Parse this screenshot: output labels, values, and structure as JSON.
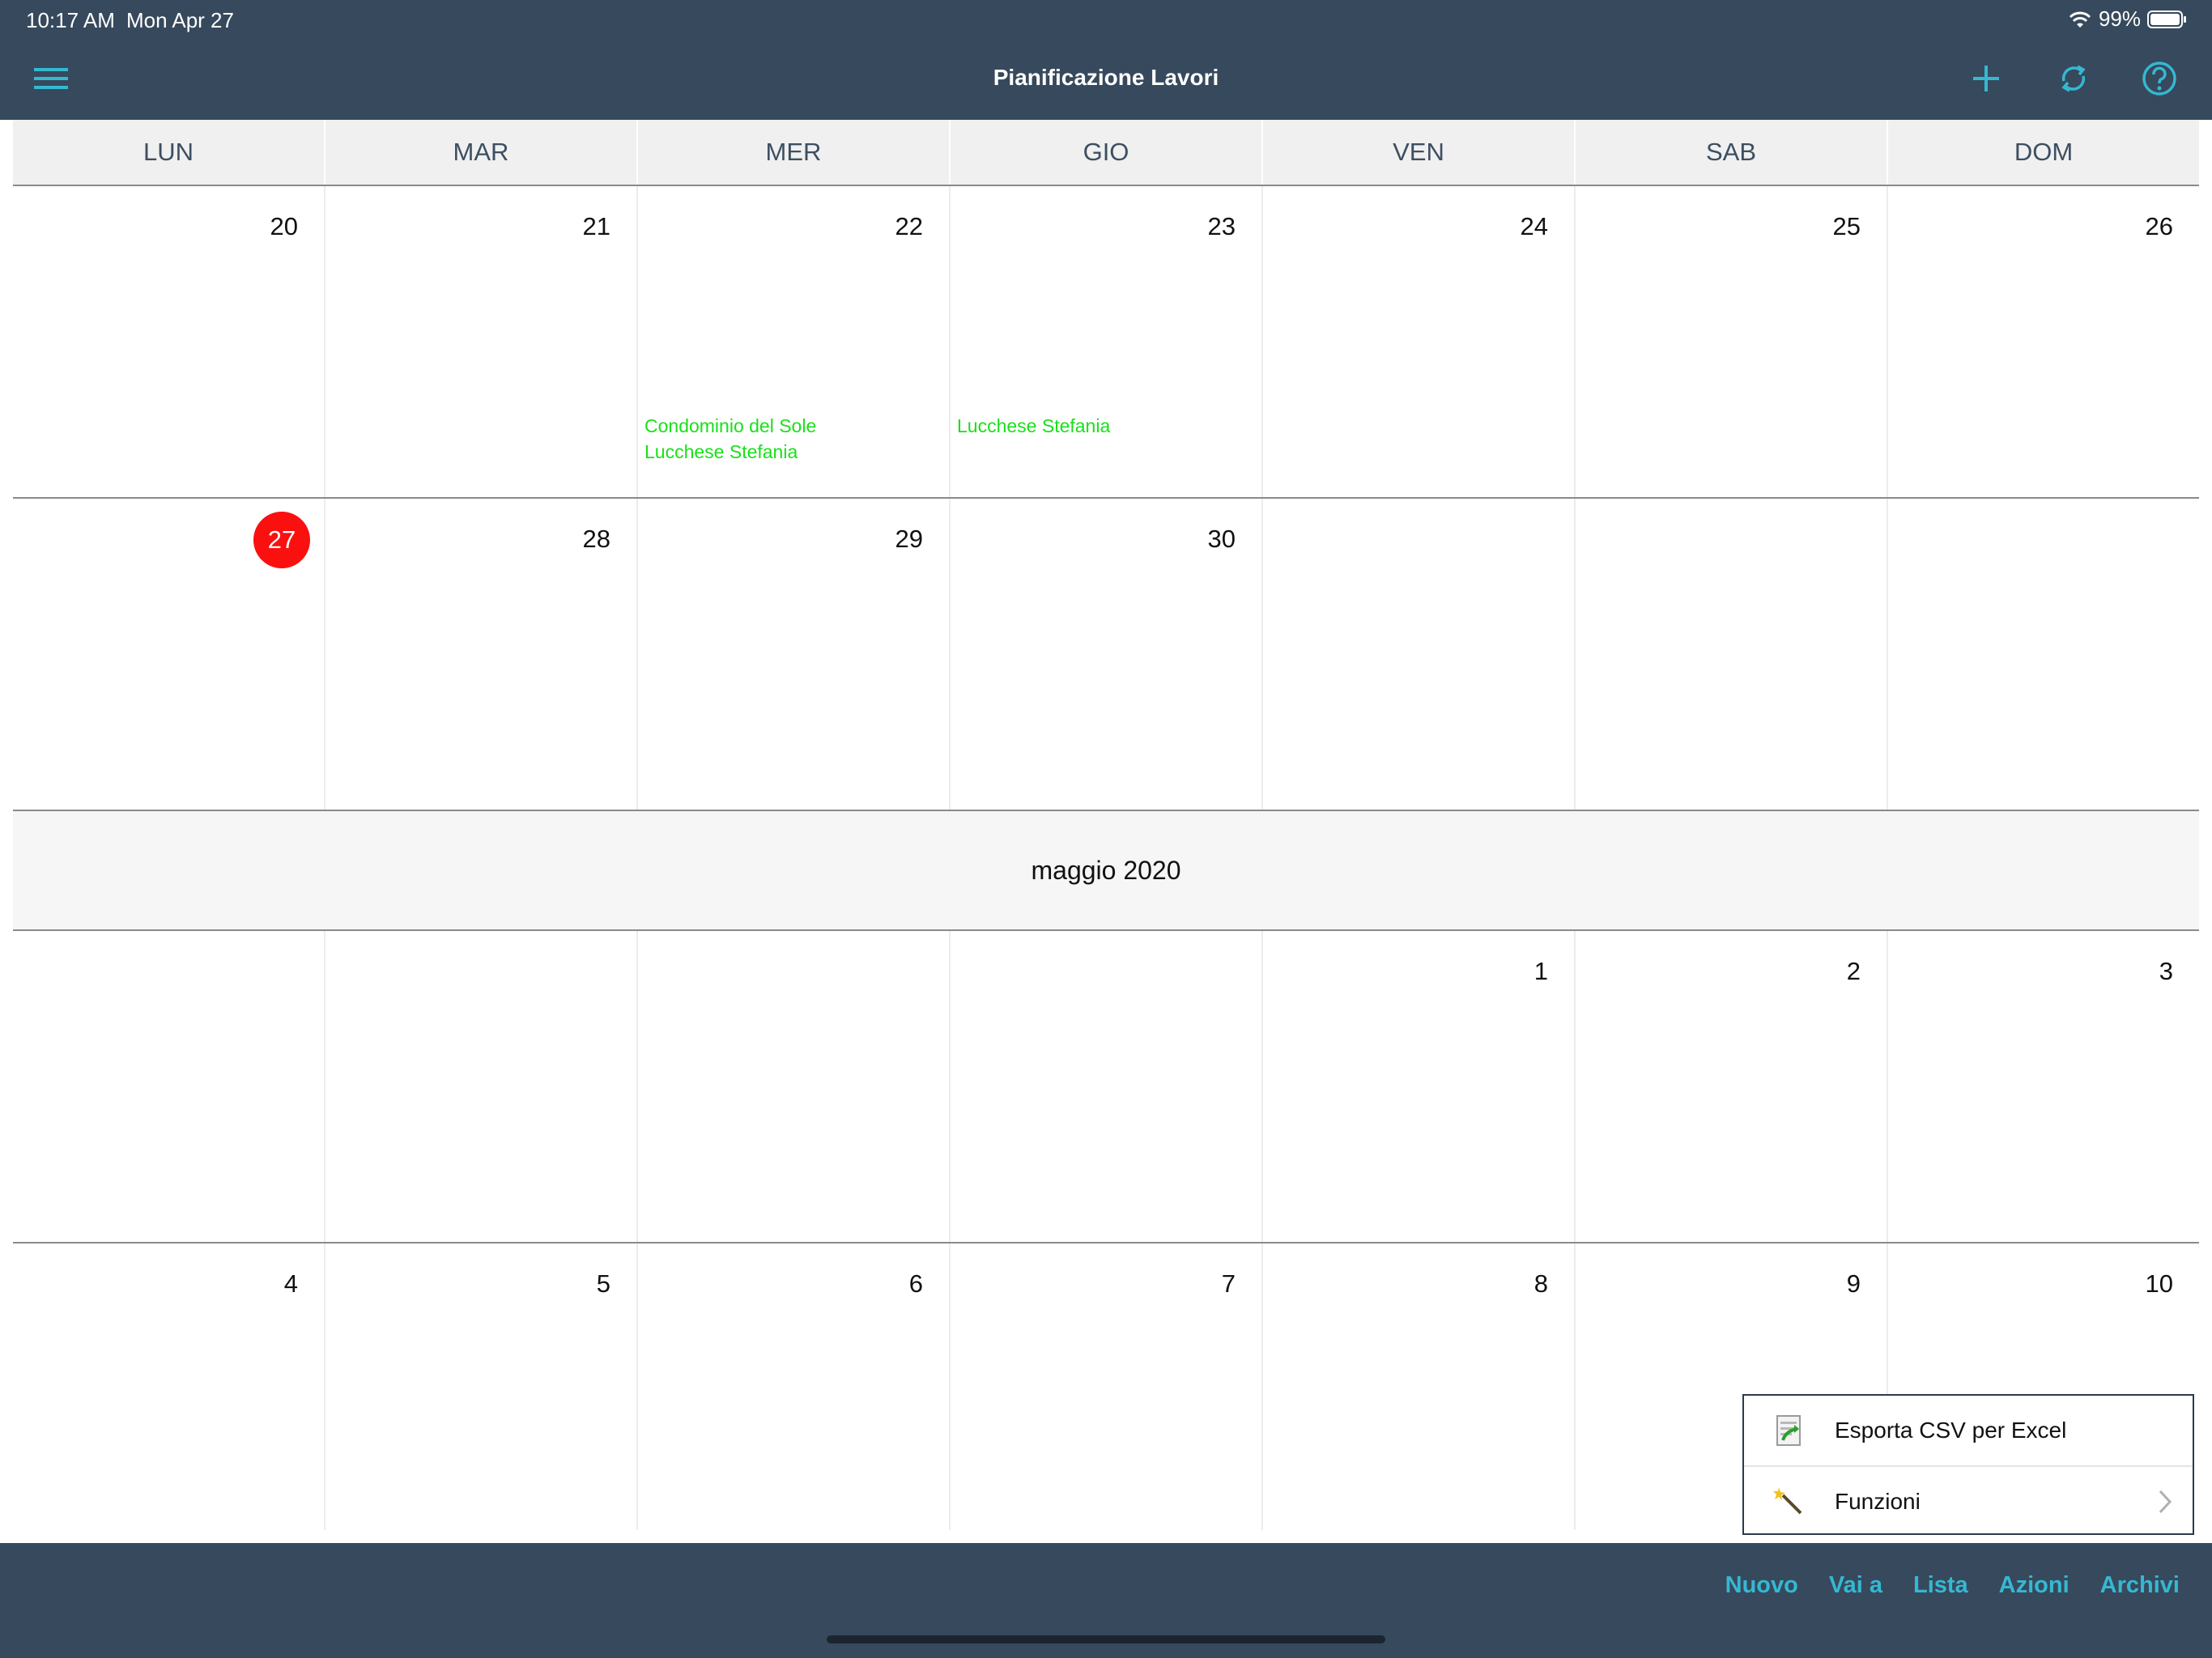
{
  "status_bar": {
    "time": "10:17 AM",
    "date": "Mon Apr 27",
    "battery": "99%"
  },
  "nav": {
    "title": "Pianificazione Lavori",
    "icons": [
      "menu-icon",
      "add-icon",
      "sync-icon",
      "help-icon"
    ]
  },
  "colors": {
    "bar_bg": "#37495c",
    "accent": "#35b8d2",
    "event_text": "#19e019",
    "today": "#fb1010"
  },
  "weekdays": [
    "LUN",
    "MAR",
    "MER",
    "GIO",
    "VEN",
    "SAB",
    "DOM"
  ],
  "weeks": [
    {
      "days": [
        {
          "num": "20",
          "events": []
        },
        {
          "num": "21",
          "events": []
        },
        {
          "num": "22",
          "events": [
            "Condominio del Sole",
            "Lucchese Stefania"
          ]
        },
        {
          "num": "23",
          "events": [
            "Lucchese Stefania"
          ]
        },
        {
          "num": "24",
          "events": []
        },
        {
          "num": "25",
          "events": []
        },
        {
          "num": "26",
          "events": []
        }
      ]
    },
    {
      "days": [
        {
          "num": "27",
          "today": true,
          "events": []
        },
        {
          "num": "28",
          "events": []
        },
        {
          "num": "29",
          "events": []
        },
        {
          "num": "30",
          "events": []
        },
        {
          "num": "",
          "events": []
        },
        {
          "num": "",
          "events": []
        },
        {
          "num": "",
          "events": []
        }
      ]
    }
  ],
  "month_label": "maggio 2020",
  "weeks_after": [
    {
      "days": [
        {
          "num": ""
        },
        {
          "num": ""
        },
        {
          "num": ""
        },
        {
          "num": ""
        },
        {
          "num": "1"
        },
        {
          "num": "2"
        },
        {
          "num": "3"
        }
      ]
    },
    {
      "days": [
        {
          "num": "4"
        },
        {
          "num": "5"
        },
        {
          "num": "6"
        },
        {
          "num": "7"
        },
        {
          "num": "8"
        },
        {
          "num": "9"
        },
        {
          "num": "10"
        }
      ]
    }
  ],
  "popup_menu": {
    "items": [
      {
        "label": "Esporta CSV per Excel",
        "icon": "csv-export-icon"
      },
      {
        "label": "Funzioni",
        "icon": "magic-wand-icon",
        "has_submenu": true
      }
    ]
  },
  "toolbar": {
    "buttons": [
      "Nuovo",
      "Vai a",
      "Lista",
      "Azioni",
      "Archivi"
    ]
  }
}
